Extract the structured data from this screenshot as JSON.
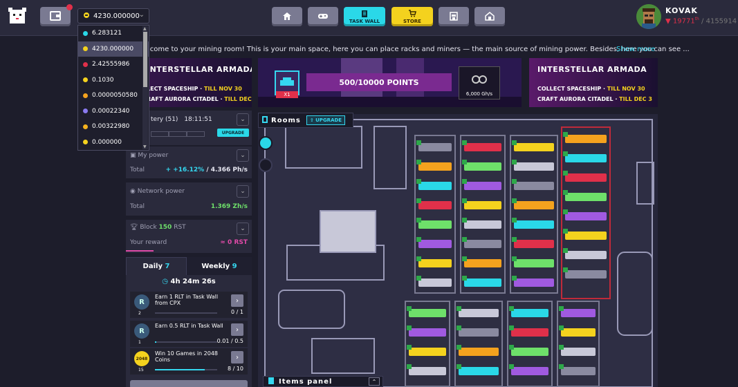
{
  "header": {
    "currency_selected": "4230.000000",
    "nav": [
      {
        "name": "home",
        "label": "",
        "icon": "home-icon"
      },
      {
        "name": "games",
        "label": "",
        "icon": "gamepad-icon"
      },
      {
        "name": "task-wall",
        "label": "TASK WALL",
        "icon": "clipboard-icon"
      },
      {
        "name": "store",
        "label": "STORE",
        "icon": "cart-icon"
      },
      {
        "name": "marketplace",
        "label": "",
        "icon": "shop-icon"
      },
      {
        "name": "my-room",
        "label": "",
        "icon": "house-icon"
      }
    ],
    "user": {
      "name": "KOVAK",
      "rank": "19771",
      "rank_suffix": "th",
      "total": "/ 4155914"
    }
  },
  "currency_list": [
    {
      "value": "6.283121",
      "color": "#2ad8e8"
    },
    {
      "value": "4230.000000",
      "color": "#f4d21e"
    },
    {
      "value": "2.42555986",
      "color": "#e0304a"
    },
    {
      "value": "0.1030",
      "color": "#f4d21e"
    },
    {
      "value": "0.0000050580",
      "color": "#f4a21e"
    },
    {
      "value": "0.00022340",
      "color": "#8a7af0"
    },
    {
      "value": "0.00322980",
      "color": "#f4b21e"
    },
    {
      "value": "0.000000",
      "color": "#f4d21e"
    }
  ],
  "welcome": {
    "text": "lcome to your mining room! This is your main space, here you can place racks and miners — the main source of mining power. Besides, here you can see ...",
    "show_more": "Show more"
  },
  "banners": {
    "left": {
      "title": "INTERSTELLAR ARMADA",
      "line1": "LECT SPACESHIP · ",
      "line1_hl": "TILL NOV 30",
      "line2": "RAFT AURORA CITADEL · ",
      "line2_hl": "TILL DEC 3"
    },
    "mid": {
      "multiplier": "X1",
      "points": "500/10000 POINTS",
      "power": "6,000 Gh/s"
    },
    "right": {
      "title": "INTERSTELLAR ARMADA",
      "line1": "COLLECT SPACESHIP · ",
      "line1_hl": "TILL NOV 30",
      "line2": "CRAFT AURORA CITADEL · ",
      "line2_hl": "TILL DEC 3"
    }
  },
  "sidebar": {
    "battery": {
      "label": "tery (51)",
      "time": "18:11:51",
      "upgrade": "UPGRADE"
    },
    "my_power": {
      "label": "My power",
      "total_label": "Total",
      "change": "+ +16.12%",
      "sep": " / ",
      "value": "4.366 Ph/s"
    },
    "network_power": {
      "label": "Network power",
      "total_label": "Total",
      "value": "1.369 Zh/s"
    },
    "block": {
      "label": "Block",
      "value": "150",
      "unit": "RST",
      "reward_label": "Your reward",
      "reward": "≈ 0 RST"
    }
  },
  "tasks": {
    "tabs": [
      {
        "label": "Daily",
        "count": "7"
      },
      {
        "label": "Weekly",
        "count": "9"
      }
    ],
    "timer": "4h 24m 26s",
    "items": [
      {
        "icon_text": "R",
        "icon_n": "2",
        "text": "Earn 1 RLT in Task Wall from CPX",
        "progress": "0 / 1",
        "fill": 0
      },
      {
        "icon_text": "R",
        "icon_n": "1",
        "text": "Earn 0.5 RLT in Task Wall",
        "progress": "0.01 / 0.5",
        "fill": 0.02
      },
      {
        "icon_text": "2048",
        "icon_n": "15",
        "text": "Win 10 Games in 2048 Coins",
        "progress": "8 / 10",
        "fill": 0.8
      }
    ]
  },
  "room": {
    "rooms_label": "Rooms",
    "upgrade_label": "UPGRADE",
    "items_panel_label": "Items panel"
  },
  "colors": {
    "accent": "#2ad8e8",
    "store": "#f4d21e",
    "danger": "#e0304a",
    "positive": "#6ee06a"
  }
}
